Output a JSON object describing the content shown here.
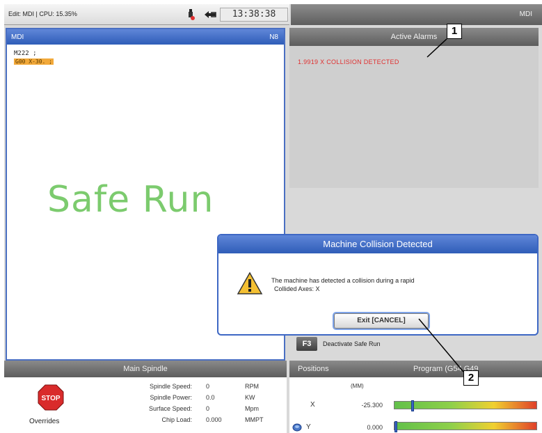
{
  "status_bar": {
    "mode": "Edit: MDI | CPU: 15.35%",
    "clock": "13:38:38",
    "usb_icon": "usb-icon",
    "network_icon": "network-icon"
  },
  "top_right": {
    "title": "MDI"
  },
  "mdi_panel": {
    "title": "MDI",
    "line_number": "N8",
    "code": [
      "M222 ;",
      "G00 X-30. ;"
    ],
    "watermark": "Safe Run"
  },
  "alarms": {
    "title": "Active Alarms",
    "items": [
      "1.9919  X COLLISION DETECTED"
    ]
  },
  "callouts": {
    "one": "1",
    "two": "2"
  },
  "dialog": {
    "title": "Machine Collision Detected",
    "message_line1": "The machine has detected a collision during a rapid",
    "message_line2": "Collided Axes: X",
    "button": "Exit [CANCEL]",
    "icon": "warning-icon"
  },
  "f3": {
    "key": "F3",
    "label": "Deactivate Safe Run"
  },
  "main_spindle": {
    "title": "Main Spindle",
    "stop_label": "STOP",
    "overrides_label": "Overrides",
    "rows": [
      {
        "label": "Spindle Speed:",
        "value": "0",
        "unit": "RPM"
      },
      {
        "label": "Spindle Power:",
        "value": "0.0",
        "unit": "KW"
      },
      {
        "label": "Surface Speed:",
        "value": "0",
        "unit": "Mpm"
      },
      {
        "label": "Chip Load:",
        "value": "0.000",
        "unit": "MMPT"
      }
    ]
  },
  "positions": {
    "title": "Positions",
    "subtitle": "Program (G54 G49",
    "unit": "(MM)",
    "axes": [
      {
        "name": "X",
        "value": "-25.300",
        "level": 0.12
      },
      {
        "name": "Y",
        "value": "0.000",
        "level": 0.0
      }
    ]
  },
  "colors": {
    "header_blue": "#2f5db8",
    "alarm_red": "#e03030",
    "safe_run_green": "#7ccb6e",
    "highlight_orange": "#f2a93a"
  }
}
